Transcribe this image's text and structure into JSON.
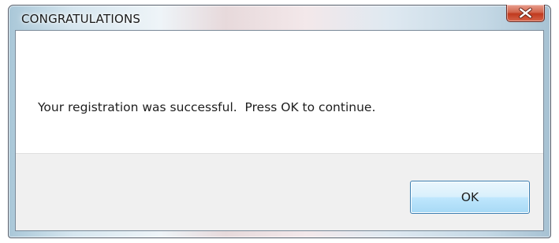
{
  "window": {
    "title": "CONGRATULATIONS",
    "close_icon": "close-icon"
  },
  "dialog": {
    "message": "Your registration was successful.  Press OK to continue.",
    "ok_label": "OK"
  },
  "colors": {
    "close_button": "#c13a1e",
    "ok_button_border": "#3c7fb1",
    "button_area_background": "#f0f0f0"
  }
}
